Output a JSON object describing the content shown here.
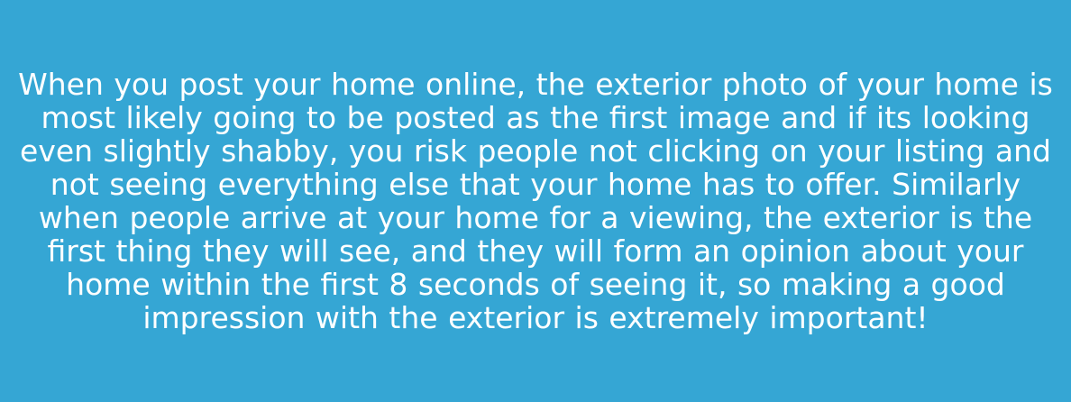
{
  "content": {
    "paragraph": "When you post your home online, the exterior photo of your home is most likely going to be posted as the first image and if its looking even slightly shabby, you risk people not clicking on your listing and not seeing everything else that your home has to offer. Similarly when people arrive at your home for a viewing, the exterior is the first thing they will see, and they will form an opinion about your home within the first 8 seconds of seeing it, so making a good impression with the exterior is extremely important!"
  },
  "colors": {
    "background": "#35a6d4",
    "text": "#ffffff"
  }
}
